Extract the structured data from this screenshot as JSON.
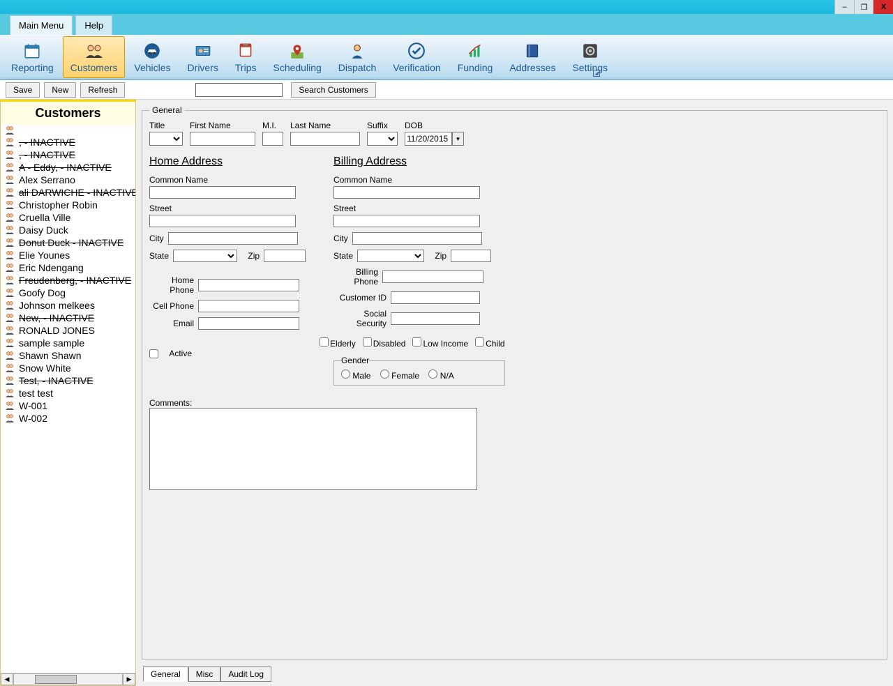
{
  "window": {
    "minimize": "–",
    "maximize": "❐",
    "close": "X"
  },
  "menu_tabs": {
    "main": "Main Menu",
    "help": "Help"
  },
  "ribbon": [
    {
      "label": "Reporting",
      "icon": "calendar",
      "active": false
    },
    {
      "label": "Customers",
      "icon": "people",
      "active": true
    },
    {
      "label": "Vehicles",
      "icon": "car",
      "active": false
    },
    {
      "label": "Drivers",
      "icon": "id",
      "active": false
    },
    {
      "label": "Trips",
      "icon": "trip",
      "active": false
    },
    {
      "label": "Scheduling",
      "icon": "pin",
      "active": false
    },
    {
      "label": "Dispatch",
      "icon": "person",
      "active": false
    },
    {
      "label": "Verification",
      "icon": "check",
      "active": false
    },
    {
      "label": "Funding",
      "icon": "chart",
      "active": false
    },
    {
      "label": "Addresses",
      "icon": "book",
      "active": false
    },
    {
      "label": "Settings",
      "icon": "gear",
      "active": false
    }
  ],
  "toolbar": {
    "save": "Save",
    "new": "New",
    "refresh": "Refresh",
    "search_value": "",
    "search_btn": "Search Customers"
  },
  "sidebar": {
    "header": "Customers",
    "items": [
      {
        "label": ", - INACTIVE",
        "inactive": true
      },
      {
        "label": ", - INACTIVE",
        "inactive": true
      },
      {
        "label": "A - Eddy, - INACTIVE",
        "inactive": true
      },
      {
        "label": "Alex Serrano",
        "inactive": false
      },
      {
        "label": "ali DARWICHE - INACTIVE",
        "inactive": true
      },
      {
        "label": "Christopher Robin",
        "inactive": false
      },
      {
        "label": "Cruella Ville",
        "inactive": false
      },
      {
        "label": "Daisy Duck",
        "inactive": false
      },
      {
        "label": "Donut Duck - INACTIVE",
        "inactive": true
      },
      {
        "label": "Elie  Younes",
        "inactive": false
      },
      {
        "label": "Eric Ndengang",
        "inactive": false
      },
      {
        "label": "Freudenberg, - INACTIVE",
        "inactive": true
      },
      {
        "label": "Goofy Dog",
        "inactive": false
      },
      {
        "label": "Johnson melkees",
        "inactive": false
      },
      {
        "label": "New, - INACTIVE",
        "inactive": true
      },
      {
        "label": "RONALD JONES",
        "inactive": false
      },
      {
        "label": "sample sample",
        "inactive": false
      },
      {
        "label": "Shawn Shawn",
        "inactive": false
      },
      {
        "label": "Snow White",
        "inactive": false
      },
      {
        "label": "Test, - INACTIVE",
        "inactive": true
      },
      {
        "label": "test test",
        "inactive": false
      },
      {
        "label": "W-001",
        "inactive": false
      },
      {
        "label": "W-002",
        "inactive": false
      }
    ]
  },
  "form": {
    "legend": "General",
    "title_lbl": "Title",
    "first_lbl": "First Name",
    "mi_lbl": "M.I.",
    "last_lbl": "Last Name",
    "suffix_lbl": "Suffix",
    "dob_lbl": "DOB",
    "dob_value": "11/20/2015",
    "home_addr_hdr": "Home Address",
    "billing_addr_hdr": "Billing Address",
    "common_name_lbl": "Common Name",
    "street_lbl": "Street",
    "city_lbl": "City",
    "state_lbl": "State",
    "zip_lbl": "Zip",
    "home_phone_lbl": "Home Phone",
    "cell_phone_lbl": "Cell Phone",
    "email_lbl": "Email",
    "billing_phone_lbl": "Billing Phone",
    "customer_id_lbl": "Customer ID",
    "ssn_lbl": "Social Security",
    "elderly_lbl": "Elderly",
    "disabled_lbl": "Disabled",
    "lowincome_lbl": "Low Income",
    "child_lbl": "Child",
    "active_lbl": "Active",
    "gender_legend": "Gender",
    "male_lbl": "Male",
    "female_lbl": "Female",
    "na_lbl": "N/A",
    "comments_lbl": "Comments:"
  },
  "bottom_tabs": {
    "general": "General",
    "misc": "Misc",
    "audit": "Audit Log"
  }
}
